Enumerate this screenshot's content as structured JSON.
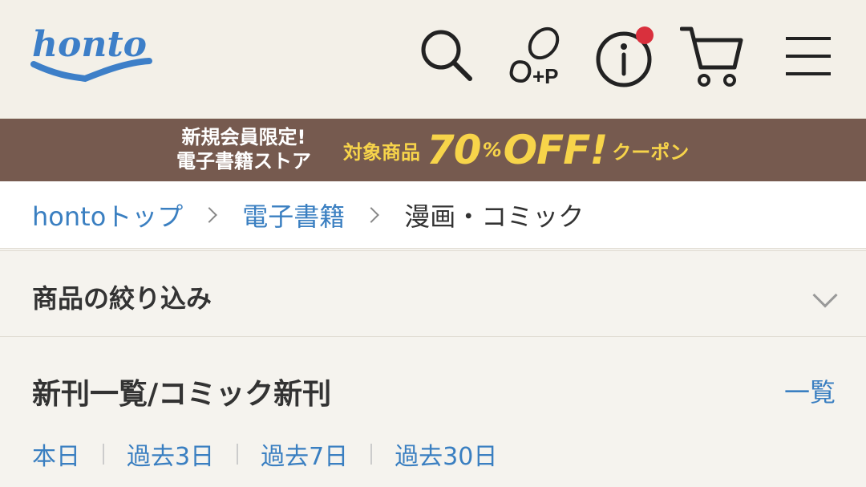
{
  "header": {
    "logo_text": "honto",
    "icons": [
      "search-icon",
      "footprint-point-icon",
      "info-icon",
      "cart-icon",
      "hamburger-menu-icon"
    ],
    "point_label": "+P",
    "notification_color": "#d9303d"
  },
  "banner": {
    "line1": "新規会員限定!",
    "line2": "電子書籍ストア",
    "item": "対象商品",
    "num": "70",
    "pct": "%",
    "off": "OFF!",
    "coupon": "クーポン",
    "bg_color": "#765a4f",
    "accent_color": "#f7d44a"
  },
  "breadcrumb": {
    "items": [
      {
        "label": "hontoトップ"
      },
      {
        "label": "電子書籍"
      },
      {
        "label": "漫画・コミック"
      }
    ]
  },
  "filter": {
    "label": "商品の絞り込み"
  },
  "section": {
    "title": "新刊一覧/コミック新刊",
    "link": "一覧",
    "tabs": [
      {
        "label": "本日"
      },
      {
        "label": "過去3日"
      },
      {
        "label": "過去7日"
      },
      {
        "label": "過去30日"
      }
    ]
  },
  "colors": {
    "link": "#3a7fc1",
    "logo": "#3d7fc8"
  }
}
